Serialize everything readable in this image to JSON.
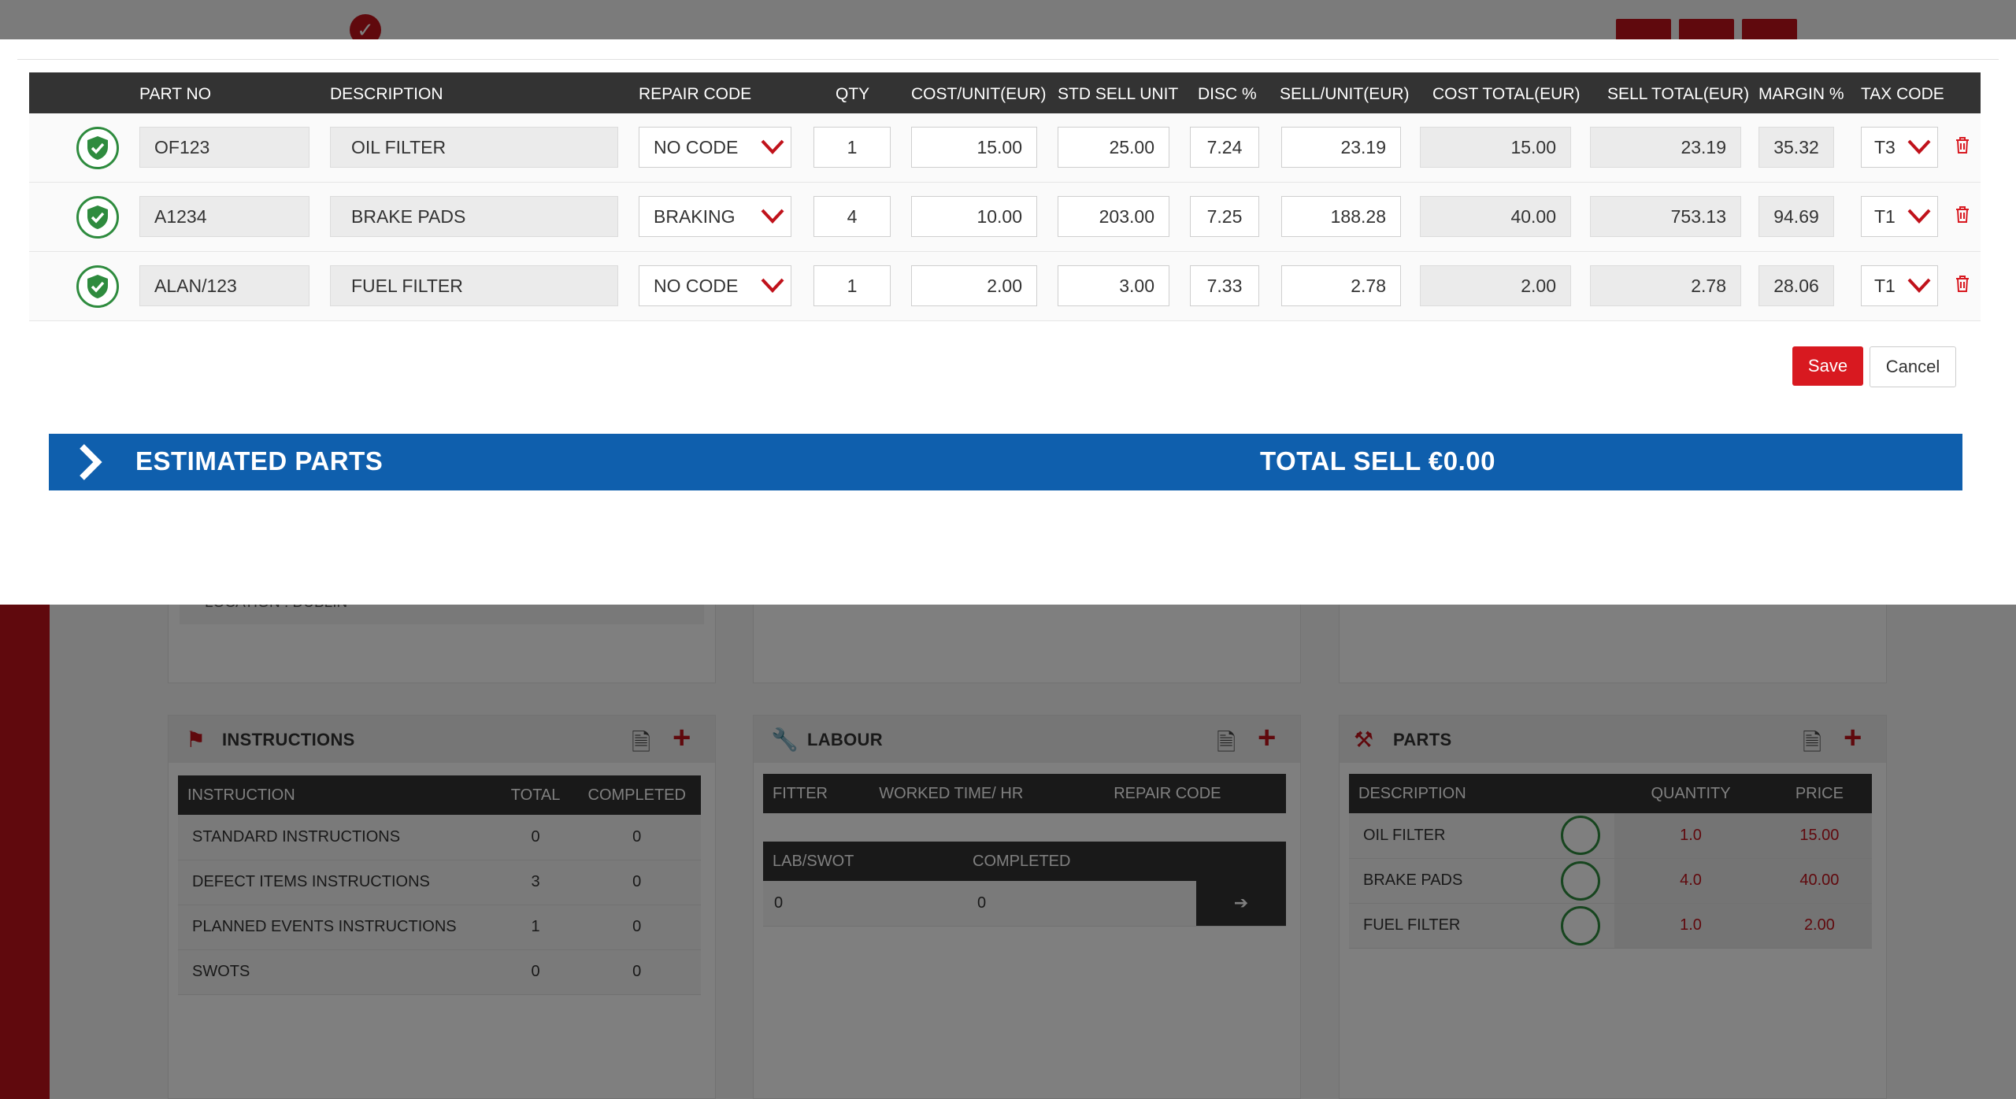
{
  "parts_table": {
    "headers": [
      "PART NO",
      "DESCRIPTION",
      "REPAIR CODE",
      "QTY",
      "COST/UNIT(EUR)",
      "STD SELL UNIT",
      "DISC %",
      "SELL/UNIT(EUR)",
      "COST TOTAL(EUR)",
      "SELL TOTAL(EUR)",
      "MARGIN %",
      "TAX CODE"
    ],
    "rows": [
      {
        "part_no": "OF123",
        "description": "OIL FILTER",
        "repair_code": "NO CODE",
        "qty": "1",
        "cost_unit": "15.00",
        "std_sell_unit": "25.00",
        "disc": "7.24",
        "sell_unit": "23.19",
        "cost_total": "15.00",
        "sell_total": "23.19",
        "margin": "35.32",
        "tax_code": "T3"
      },
      {
        "part_no": "A1234",
        "description": "BRAKE PADS",
        "repair_code": "BRAKING",
        "qty": "4",
        "cost_unit": "10.00",
        "std_sell_unit": "203.00",
        "disc": "7.25",
        "sell_unit": "188.28",
        "cost_total": "40.00",
        "sell_total": "753.13",
        "margin": "94.69",
        "tax_code": "T1"
      },
      {
        "part_no": "ALAN/123",
        "description": "FUEL FILTER",
        "repair_code": "NO CODE",
        "qty": "1",
        "cost_unit": "2.00",
        "std_sell_unit": "3.00",
        "disc": "7.33",
        "sell_unit": "2.78",
        "cost_total": "2.00",
        "sell_total": "2.78",
        "margin": "28.06",
        "tax_code": "T1"
      }
    ]
  },
  "actions": {
    "save": "Save",
    "cancel": "Cancel"
  },
  "estimated": {
    "title": "ESTIMATED PARTS",
    "total": "TOTAL SELL €0.00"
  },
  "background": {
    "location": "LOCATION : DUBLIN",
    "instructions": {
      "title": "INSTRUCTIONS",
      "headers": [
        "INSTRUCTION",
        "TOTAL",
        "COMPLETED"
      ],
      "rows": [
        {
          "name": "STANDARD INSTRUCTIONS",
          "total": "0",
          "completed": "0"
        },
        {
          "name": "DEFECT ITEMS INSTRUCTIONS",
          "total": "3",
          "completed": "0"
        },
        {
          "name": "PLANNED EVENTS INSTRUCTIONS",
          "total": "1",
          "completed": "0"
        },
        {
          "name": "SWOTS",
          "total": "0",
          "completed": "0"
        }
      ]
    },
    "labour": {
      "title": "LABOUR",
      "headers": [
        "FITTER",
        "WORKED TIME/ HR",
        "REPAIR CODE"
      ],
      "sub_headers": [
        "LAB/SWOT",
        "COMPLETED"
      ],
      "sub_row": {
        "lab_swot": "0",
        "completed": "0"
      }
    },
    "parts": {
      "title": "PARTS",
      "headers": [
        "DESCRIPTION",
        "QUANTITY",
        "PRICE"
      ],
      "rows": [
        {
          "description": "OIL FILTER",
          "quantity": "1.0",
          "price": "15.00"
        },
        {
          "description": "BRAKE PADS",
          "quantity": "4.0",
          "price": "40.00"
        },
        {
          "description": "FUEL FILTER",
          "quantity": "1.0",
          "price": "2.00"
        }
      ]
    }
  },
  "colors": {
    "accent_red": "#d81920",
    "header_dark": "#333333",
    "banner_blue": "#0f5fad",
    "check_green": "#2e8b3e"
  },
  "icons": [
    "check-shield-icon",
    "chevron-down-icon",
    "trash-icon",
    "chevron-right-icon",
    "document-search-icon",
    "plus-icon",
    "wrench-icon",
    "tools-icon",
    "flag-icon",
    "arrow-right-icon"
  ]
}
